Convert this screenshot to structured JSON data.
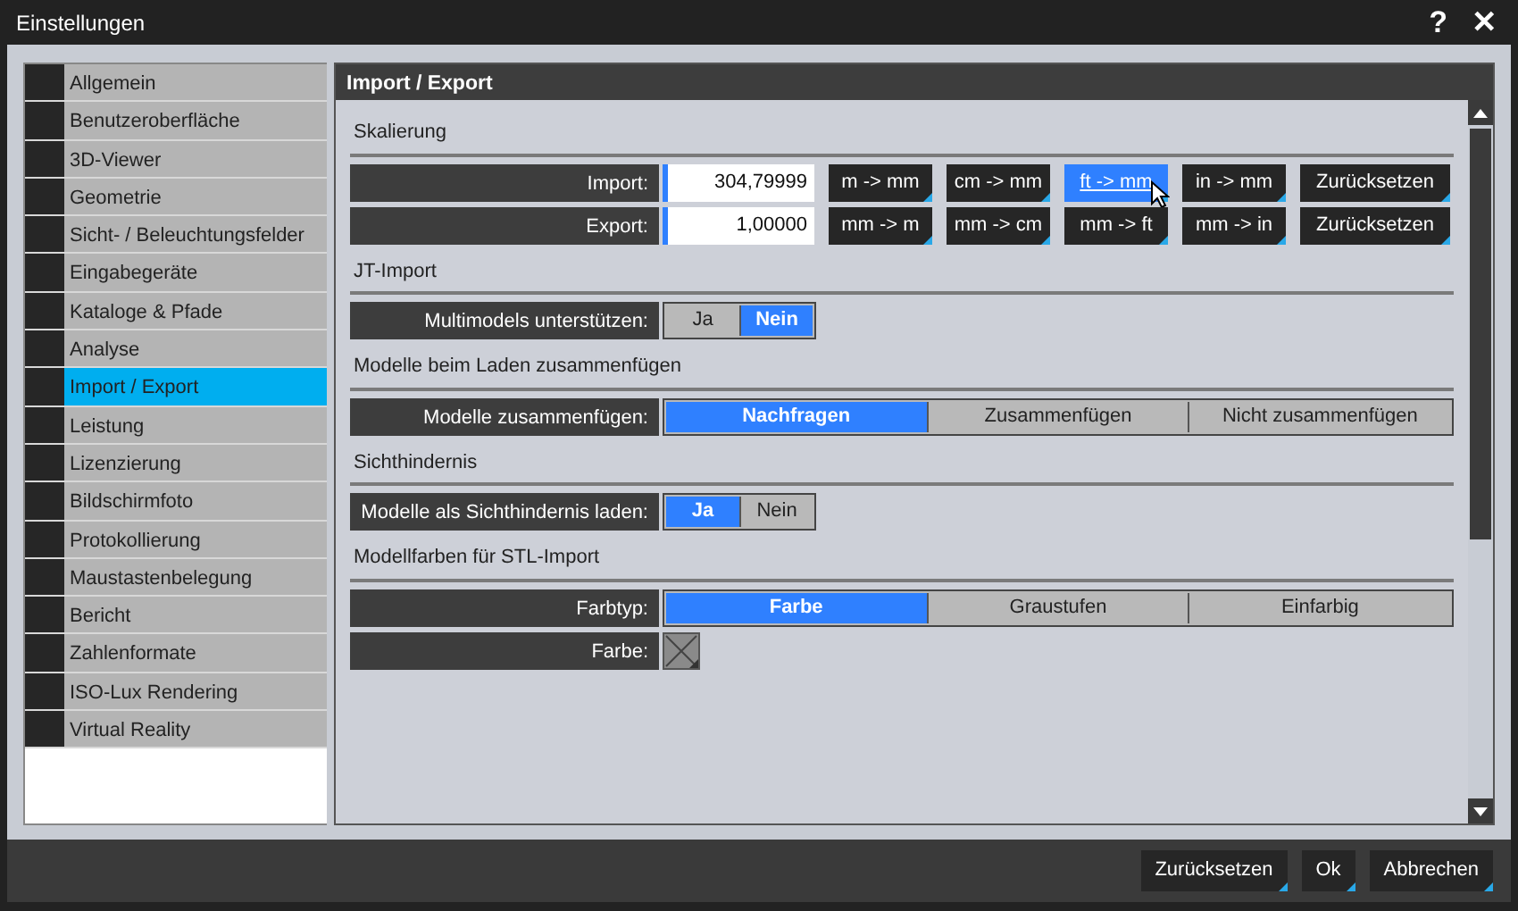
{
  "window": {
    "title": "Einstellungen",
    "help": "?",
    "close": "✕"
  },
  "sidebar": {
    "items": [
      {
        "label": "Allgemein",
        "selected": false
      },
      {
        "label": "Benutzeroberfläche",
        "selected": false
      },
      {
        "label": "3D-Viewer",
        "selected": false
      },
      {
        "label": "Geometrie",
        "selected": false
      },
      {
        "label": "Sicht- / Beleuchtungsfelder",
        "selected": false
      },
      {
        "label": "Eingabegeräte",
        "selected": false
      },
      {
        "label": "Kataloge & Pfade",
        "selected": false
      },
      {
        "label": "Analyse",
        "selected": false
      },
      {
        "label": "Import / Export",
        "selected": true
      },
      {
        "label": "Leistung",
        "selected": false
      },
      {
        "label": "Lizenzierung",
        "selected": false
      },
      {
        "label": "Bildschirmfoto",
        "selected": false
      },
      {
        "label": "Protokollierung",
        "selected": false
      },
      {
        "label": "Maustastenbelegung",
        "selected": false
      },
      {
        "label": "Bericht",
        "selected": false
      },
      {
        "label": "Zahlenformate",
        "selected": false
      },
      {
        "label": "ISO-Lux Rendering",
        "selected": false
      },
      {
        "label": "Virtual Reality",
        "selected": false
      }
    ]
  },
  "panel": {
    "title": "Import / Export",
    "sections": [
      {
        "heading": "Skalierung",
        "rows": [
          {
            "kind": "scale",
            "label": "Import:",
            "value": "304,79999",
            "buttons": [
              {
                "label": "m -> mm",
                "hovered": false
              },
              {
                "label": "cm -> mm",
                "hovered": false
              },
              {
                "label": "ft -> mm",
                "hovered": true
              },
              {
                "label": "in -> mm",
                "hovered": false
              },
              {
                "label": "Zurücksetzen",
                "hovered": false
              }
            ]
          },
          {
            "kind": "scale",
            "label": "Export:",
            "value": "1,00000",
            "buttons": [
              {
                "label": "mm -> m",
                "hovered": false
              },
              {
                "label": "mm -> cm",
                "hovered": false
              },
              {
                "label": "mm -> ft",
                "hovered": false
              },
              {
                "label": "mm -> in",
                "hovered": false
              },
              {
                "label": "Zurücksetzen",
                "hovered": false
              }
            ]
          }
        ]
      },
      {
        "heading": "JT-Import",
        "rows": [
          {
            "kind": "toggle",
            "label": "Multimodels unterstützen:",
            "options": [
              {
                "label": "Ja",
                "selected": false
              },
              {
                "label": "Nein",
                "selected": true
              }
            ]
          }
        ]
      },
      {
        "heading": "Modelle beim Laden zusammenfügen",
        "rows": [
          {
            "kind": "segments",
            "label": "Modelle zusammenfügen:",
            "options": [
              {
                "label": "Nachfragen",
                "selected": true
              },
              {
                "label": "Zusammenfügen",
                "selected": false
              },
              {
                "label": "Nicht zusammenfügen",
                "selected": false
              }
            ]
          }
        ]
      },
      {
        "heading": "Sichthindernis",
        "rows": [
          {
            "kind": "toggle",
            "label": "Modelle als Sichthindernis laden:",
            "options": [
              {
                "label": "Ja",
                "selected": true
              },
              {
                "label": "Nein",
                "selected": false
              }
            ]
          }
        ]
      },
      {
        "heading": "Modellfarben für STL-Import",
        "rows": [
          {
            "kind": "segments",
            "label": "Farbtyp:",
            "options": [
              {
                "label": "Farbe",
                "selected": true
              },
              {
                "label": "Graustufen",
                "selected": false
              },
              {
                "label": "Einfarbig",
                "selected": false
              }
            ]
          },
          {
            "kind": "color",
            "label": "Farbe:"
          }
        ]
      }
    ]
  },
  "footer": {
    "buttons": [
      "Zurücksetzen",
      "Ok",
      "Abbrechen"
    ]
  }
}
